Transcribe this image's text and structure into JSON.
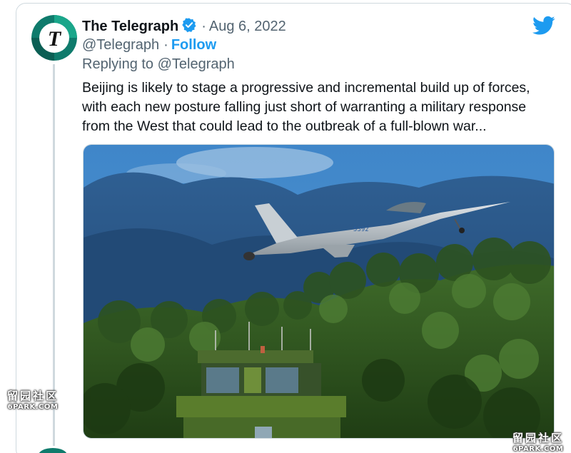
{
  "tweet": {
    "display_name": "The Telegraph",
    "date": "Aug 6, 2022",
    "separator": "·",
    "handle": "@Telegraph",
    "follow_label": "Follow",
    "replying_prefix": "Replying to",
    "replying_handle": "@Telegraph",
    "text": "Beijing is likely to stage a progressive and incremental build up of forces, with each new posture falling just short of warranting a military response from the West that could lead to the outbreak of a full-blown war...",
    "avatar_letter": "T"
  },
  "image": {
    "aircraft_tail_number": "5392"
  },
  "watermark": {
    "chinese": "留园社区",
    "site": "6PARK.COM"
  },
  "colors": {
    "accent": "#1d9bf0",
    "text": "#0f1419",
    "muted": "#536471",
    "avatar_teal": "#0f7b6c"
  },
  "icons": [
    "verified-badge-icon",
    "twitter-bird-icon"
  ]
}
